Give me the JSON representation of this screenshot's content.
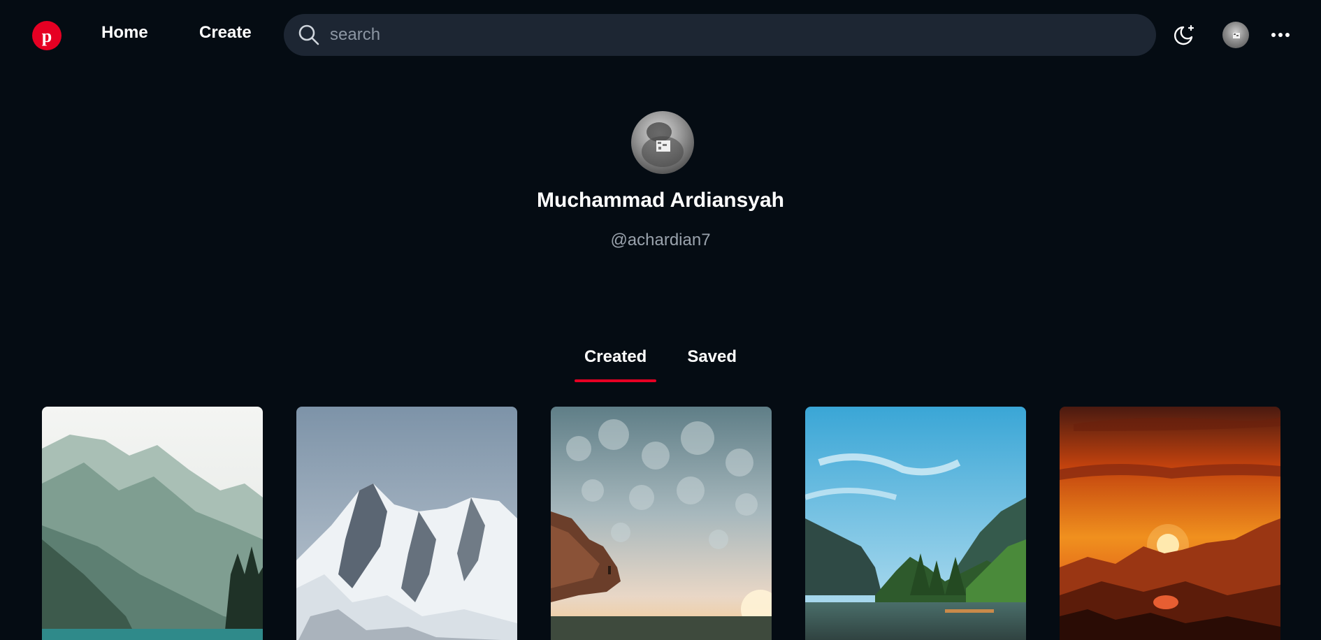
{
  "nav": {
    "logo_icon": "pinterest-logo-icon",
    "home_label": "Home",
    "create_label": "Create",
    "search_placeholder": "search",
    "theme_icon": "moon-icon",
    "more_icon": "more-dots-icon",
    "brand_color": "#e60023"
  },
  "profile": {
    "name": "Muchammad Ardiansyah",
    "handle": "@achardian7"
  },
  "tabs": [
    {
      "label": "Created",
      "active": true
    },
    {
      "label": "Saved",
      "active": false
    }
  ],
  "pins": [
    {
      "subject": "misty mountain lake"
    },
    {
      "subject": "snowy mountain peak"
    },
    {
      "subject": "cliff under cloudy sky"
    },
    {
      "subject": "green valley river"
    },
    {
      "subject": "orange mountain sunset"
    }
  ]
}
